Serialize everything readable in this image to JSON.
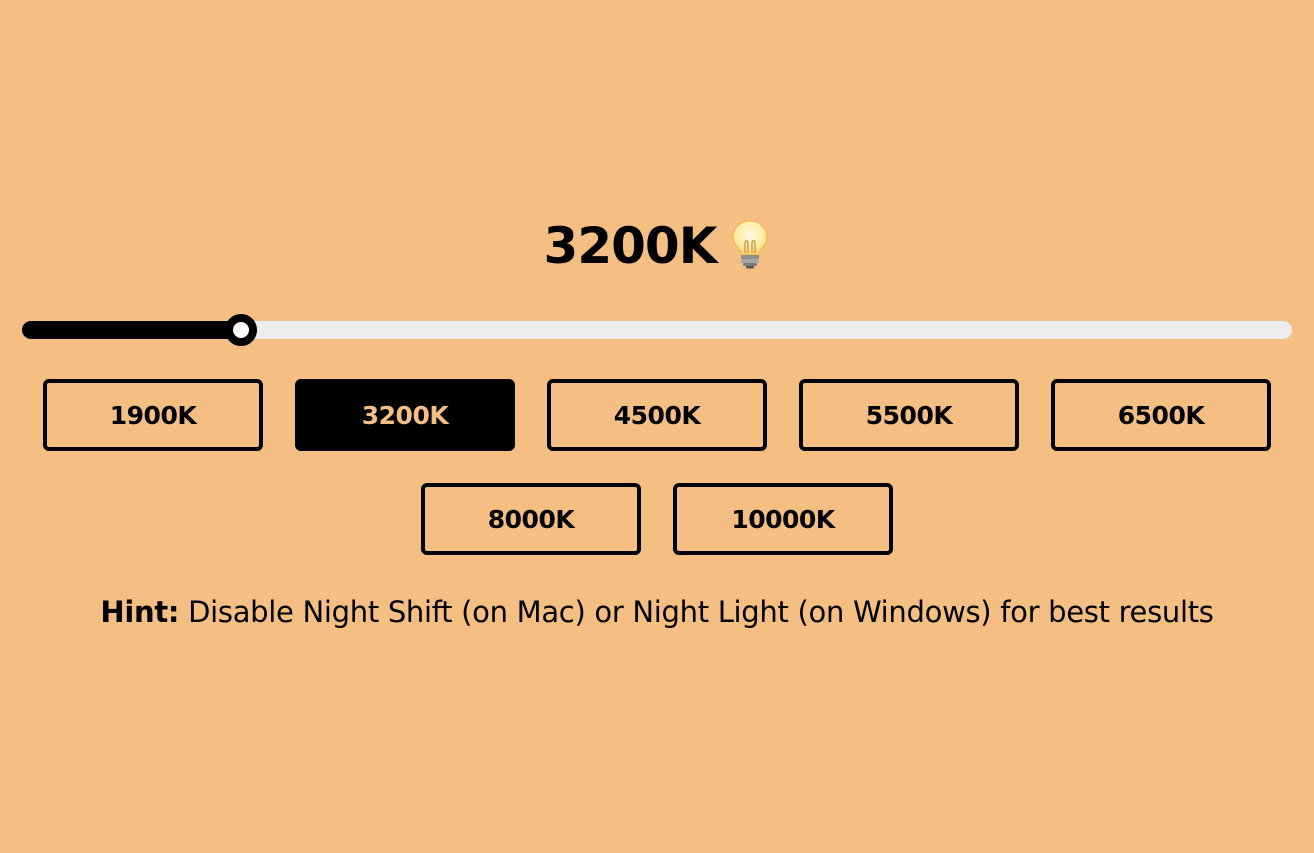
{
  "current_temperature": "3200K",
  "title_icon": "light-bulb-icon",
  "slider": {
    "min": 1900,
    "max": 10000,
    "value": 3200,
    "fill_color": "#000000",
    "track_color": "#ececec"
  },
  "presets": [
    {
      "label": "1900K",
      "active": false
    },
    {
      "label": "3200K",
      "active": true
    },
    {
      "label": "4500K",
      "active": false
    },
    {
      "label": "5500K",
      "active": false
    },
    {
      "label": "6500K",
      "active": false
    },
    {
      "label": "8000K",
      "active": false
    },
    {
      "label": "10000K",
      "active": false
    }
  ],
  "hint": {
    "label": "Hint:",
    "text": " Disable Night Shift (on Mac) or Night Light (on Windows) for best results"
  },
  "colors": {
    "background": "#f5be82",
    "accent": "#000000"
  }
}
